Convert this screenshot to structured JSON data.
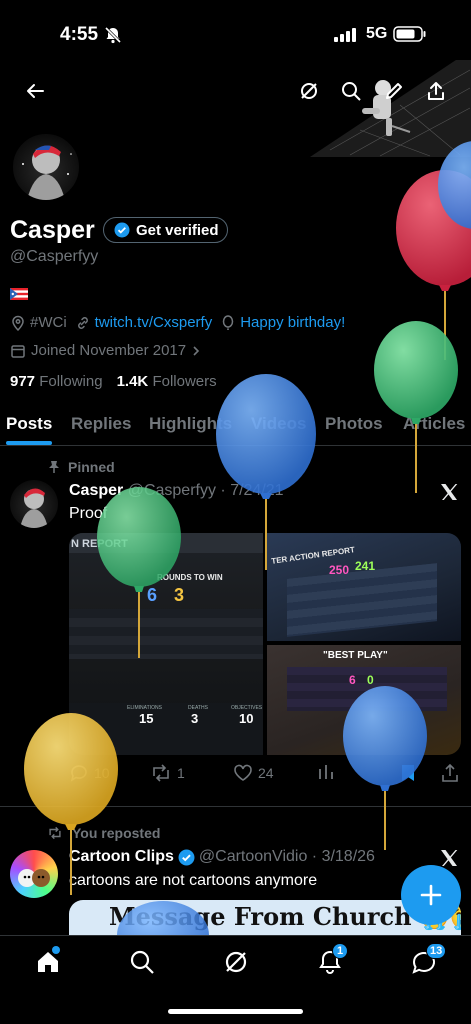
{
  "status_bar": {
    "time": "4:55",
    "network": "5G"
  },
  "profile": {
    "name": "Casper",
    "verify_label": "Get verified",
    "handle": "@Casperfyy",
    "location": "#WCi",
    "website": "twitch.tv/Cxsperfy",
    "birthday": "Happy birthday!",
    "joined": "Joined November 2017",
    "following_count": "977",
    "following_label": "Following",
    "followers_count": "1.4K",
    "followers_label": "Followers"
  },
  "tabs": [
    "Posts",
    "Replies",
    "Highlights",
    "Videos",
    "Photos",
    "Articles"
  ],
  "pinned_post": {
    "pinned_label": "Pinned",
    "author": "Casper",
    "meta": "@Casperfyy · 7/24/21",
    "text": "Proof",
    "media": {
      "m1_header": "N REPORT",
      "m1_rounds": "ROUNDS TO WIN",
      "m1_score_a": "6",
      "m1_score_b": "3",
      "m1_stats": [
        "15",
        "3",
        "10"
      ],
      "m1_stat_labels": [
        "ELIMINATIONS",
        "DEATHS",
        "OBJECTIVES"
      ],
      "m2_header": "TER ACTION REPORT",
      "m2_score_a": "250",
      "m2_score_b": "241",
      "m3_header": "\"BEST PLAY\"",
      "m3_score_a": "6",
      "m3_score_b": "0"
    },
    "replies": "10",
    "reposts": "1",
    "likes": "24"
  },
  "repost": {
    "reposted_label": "You reposted",
    "author": "Cartoon Clips",
    "meta": "@CartoonVidio · 3/18/26",
    "text": "cartoons are not cartoons anymore",
    "media_text": "Message From Church 😭😭"
  },
  "bottom_nav": {
    "notifications_badge": "1",
    "messages_badge": "13"
  },
  "colors": {
    "accent": "#1d9bf0",
    "background": "#000000",
    "muted": "#71767b"
  }
}
